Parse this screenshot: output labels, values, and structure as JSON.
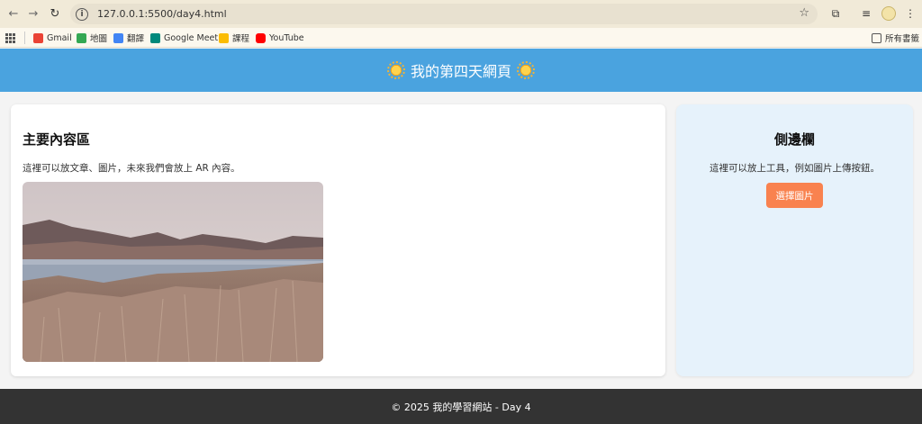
{
  "browser": {
    "url": "127.0.0.1:5500/day4.html",
    "bookmarks": [
      {
        "label": "Gmail",
        "icon": "gmail-icon",
        "color": "#ea4335"
      },
      {
        "label": "地圖",
        "icon": "maps-icon",
        "color": "#34a853"
      },
      {
        "label": "翻譯",
        "icon": "translate-icon",
        "color": "#4285f4"
      },
      {
        "label": "Google Meet",
        "icon": "meet-icon",
        "color": "#00897b"
      },
      {
        "label": "課程",
        "icon": "classroom-icon",
        "color": "#fbbc04"
      },
      {
        "label": "YouTube",
        "icon": "youtube-icon",
        "color": "#ff0000"
      }
    ],
    "all_bookmarks": "所有書籤"
  },
  "header": {
    "title": "我的第四天網頁"
  },
  "main": {
    "title": "主要內容區",
    "text": "這裡可以放文章、圖片，未來我們會放上 AR 內容。"
  },
  "sidebar": {
    "title": "側邊欄",
    "text": "這裡可以放上工具，例如圖片上傳按鈕。",
    "button": "選擇圖片"
  },
  "footer": {
    "text": "© 2025 我的學習網站 - Day 4"
  },
  "colors": {
    "header": "#4aa3df",
    "sidebar": "#e6f2fb",
    "button": "#f9824f",
    "footer": "#333333"
  }
}
